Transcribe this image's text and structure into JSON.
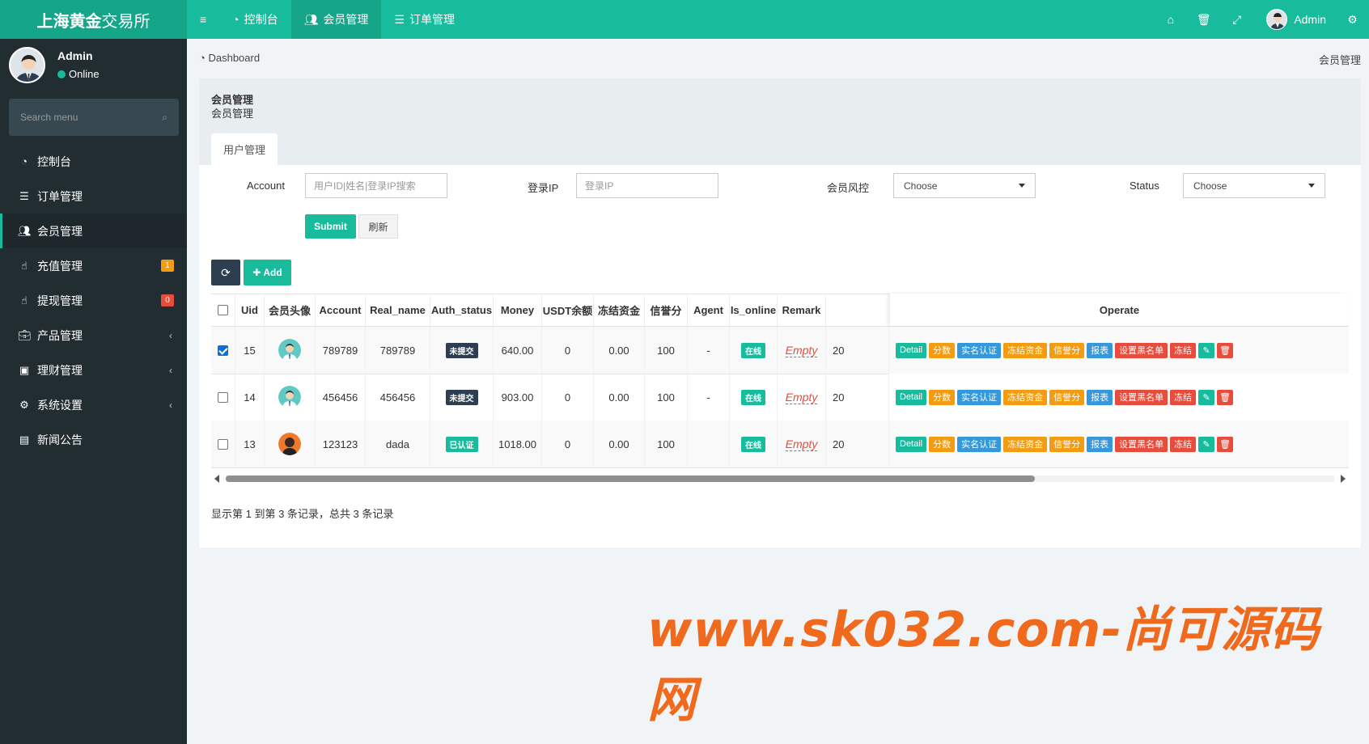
{
  "app": {
    "logo_bold": "上海黄金",
    "logo_rest": "交易所"
  },
  "topnav": [
    {
      "icon": "dashboard-icon",
      "label": "控制台"
    },
    {
      "icon": "users-icon",
      "label": "会员管理"
    },
    {
      "icon": "list-icon",
      "label": "订单管理"
    }
  ],
  "topbar": {
    "user_name": "Admin"
  },
  "sidebar": {
    "user_name": "Admin",
    "user_status": "Online",
    "search_placeholder": "Search menu",
    "items": [
      {
        "label": "控制台",
        "icon": "dashboard-icon"
      },
      {
        "label": "订单管理",
        "icon": "list-icon"
      },
      {
        "label": "会员管理",
        "icon": "users-icon",
        "active": true
      },
      {
        "label": "充值管理",
        "icon": "hand-icon",
        "badge": "1",
        "badge_color": "#f39c12"
      },
      {
        "label": "提现管理",
        "icon": "hand-icon",
        "badge": "0",
        "badge_color": "#e74c3c"
      },
      {
        "label": "产品管理",
        "icon": "briefcase-icon",
        "arrow": "‹"
      },
      {
        "label": "理财管理",
        "icon": "money-icon",
        "arrow": "‹"
      },
      {
        "label": "系统设置",
        "icon": "cogs-icon",
        "arrow": "‹"
      },
      {
        "label": "新闻公告",
        "icon": "newspaper-icon"
      }
    ]
  },
  "breadcrumb": {
    "left": "Dashboard",
    "right": "会员管理"
  },
  "panel": {
    "title": "会员管理",
    "subtitle": "会员管理",
    "tab": "用户管理"
  },
  "filters": {
    "account_label": "Account",
    "account_placeholder": "用户ID|姓名|登录IP搜索",
    "ip_label": "登录IP",
    "ip_placeholder": "登录IP",
    "risk_label": "会员风控",
    "risk_value": "Choose",
    "status_label": "Status",
    "status_value": "Choose",
    "submit": "Submit",
    "reset": "刷新"
  },
  "toolbar": {
    "add": "Add"
  },
  "table": {
    "headers": [
      "Uid",
      "会员头像",
      "Account",
      "Real_name",
      "Auth_status",
      "Money",
      "USDT余额",
      "冻结资金",
      "信誉分",
      "Agent",
      "Is_online",
      "Remark",
      "Operate"
    ],
    "rows": [
      {
        "checked": true,
        "uid": "15",
        "avatar": "male",
        "account": "789789",
        "real_name": "789789",
        "auth": "未提交",
        "auth_color": "#2c3e50",
        "money": "640.00",
        "usdt": "0",
        "frozen": "0.00",
        "credit": "100",
        "agent": "-",
        "online": "在线",
        "remark": "Empty",
        "extra": "20"
      },
      {
        "checked": false,
        "uid": "14",
        "avatar": "male",
        "account": "456456",
        "real_name": "456456",
        "auth": "未提交",
        "auth_color": "#2c3e50",
        "money": "903.00",
        "usdt": "0",
        "frozen": "0.00",
        "credit": "100",
        "agent": "-",
        "online": "在线",
        "remark": "Empty",
        "extra": "20"
      },
      {
        "checked": false,
        "uid": "13",
        "avatar": "dark",
        "account": "123123",
        "real_name": "dada",
        "auth": "已认证",
        "auth_color": "#18bc9c",
        "money": "1018.00",
        "usdt": "0",
        "frozen": "0.00",
        "credit": "100",
        "agent": "",
        "online": "在线",
        "remark": "Empty",
        "extra": "20"
      }
    ],
    "operate_buttons": [
      {
        "label": "Detail",
        "color": "#18bc9c"
      },
      {
        "label": "分数",
        "color": "#f39c12"
      },
      {
        "label": "实名认证",
        "color": "#3498db"
      },
      {
        "label": "冻结资金",
        "color": "#f39c12"
      },
      {
        "label": "信誉分",
        "color": "#f39c12"
      },
      {
        "label": "报表",
        "color": "#3498db"
      },
      {
        "label": "设置黑名单",
        "color": "#e74c3c"
      },
      {
        "label": "冻结",
        "color": "#e74c3c"
      }
    ]
  },
  "pagination": {
    "info": "显示第 1 到第 3 条记录，总共 3 条记录"
  },
  "watermark": "www.sk032.com-尚可源码网"
}
